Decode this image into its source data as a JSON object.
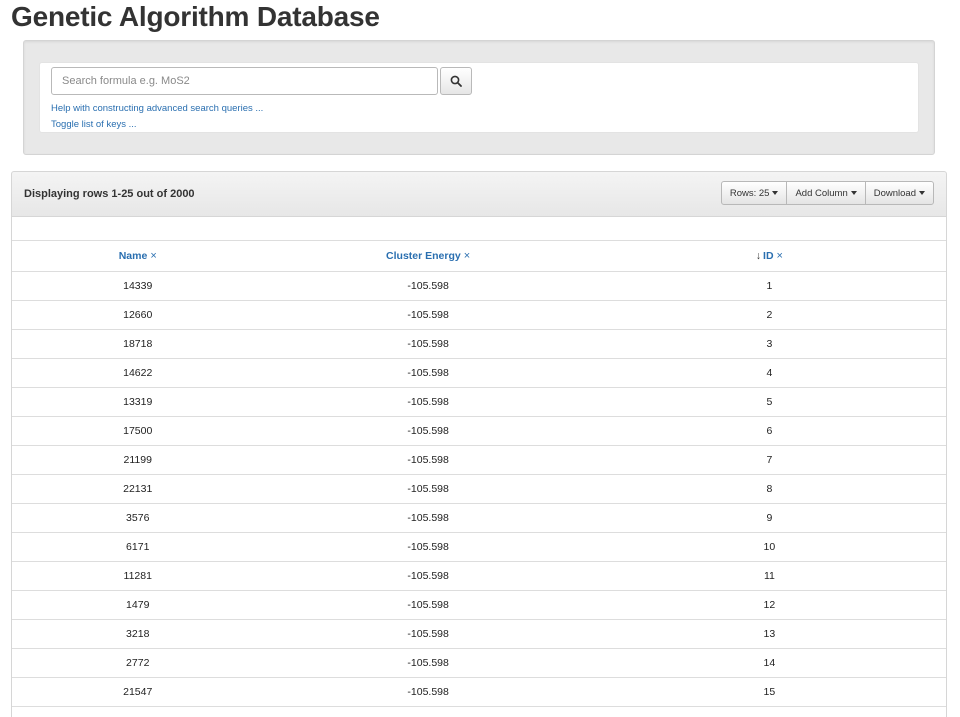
{
  "page": {
    "title": "Genetic Algorithm Database"
  },
  "search": {
    "placeholder": "Search formula e.g. MoS2",
    "value": "",
    "button_icon": "search-icon",
    "help_link": "Help with constructing advanced search queries ...",
    "keys_link": "Toggle list of keys ..."
  },
  "results": {
    "count_text": "Displaying rows 1-25 out of 2000",
    "buttons": {
      "rows": "Rows: 25",
      "add_column": "Add Column",
      "download": "Download"
    },
    "columns": [
      {
        "label": "Name",
        "remove_icon": "×"
      },
      {
        "label": "Cluster Energy",
        "remove_icon": "×"
      },
      {
        "label": "ID",
        "remove_icon": "×",
        "sort_icon": "↓"
      }
    ],
    "rows": [
      [
        "14339",
        "-105.598",
        "1"
      ],
      [
        "12660",
        "-105.598",
        "2"
      ],
      [
        "18718",
        "-105.598",
        "3"
      ],
      [
        "14622",
        "-105.598",
        "4"
      ],
      [
        "13319",
        "-105.598",
        "5"
      ],
      [
        "17500",
        "-105.598",
        "6"
      ],
      [
        "21199",
        "-105.598",
        "7"
      ],
      [
        "22131",
        "-105.598",
        "8"
      ],
      [
        "3576",
        "-105.598",
        "9"
      ],
      [
        "6171",
        "-105.598",
        "10"
      ],
      [
        "11281",
        "-105.598",
        "11"
      ],
      [
        "1479",
        "-105.598",
        "12"
      ],
      [
        "3218",
        "-105.598",
        "13"
      ],
      [
        "2772",
        "-105.598",
        "14"
      ],
      [
        "21547",
        "-105.598",
        "15"
      ]
    ]
  },
  "colors": {
    "link": "#2a6fb0",
    "text": "#333333",
    "well_bg": "#e8e8e8",
    "border": "#dddddd"
  }
}
